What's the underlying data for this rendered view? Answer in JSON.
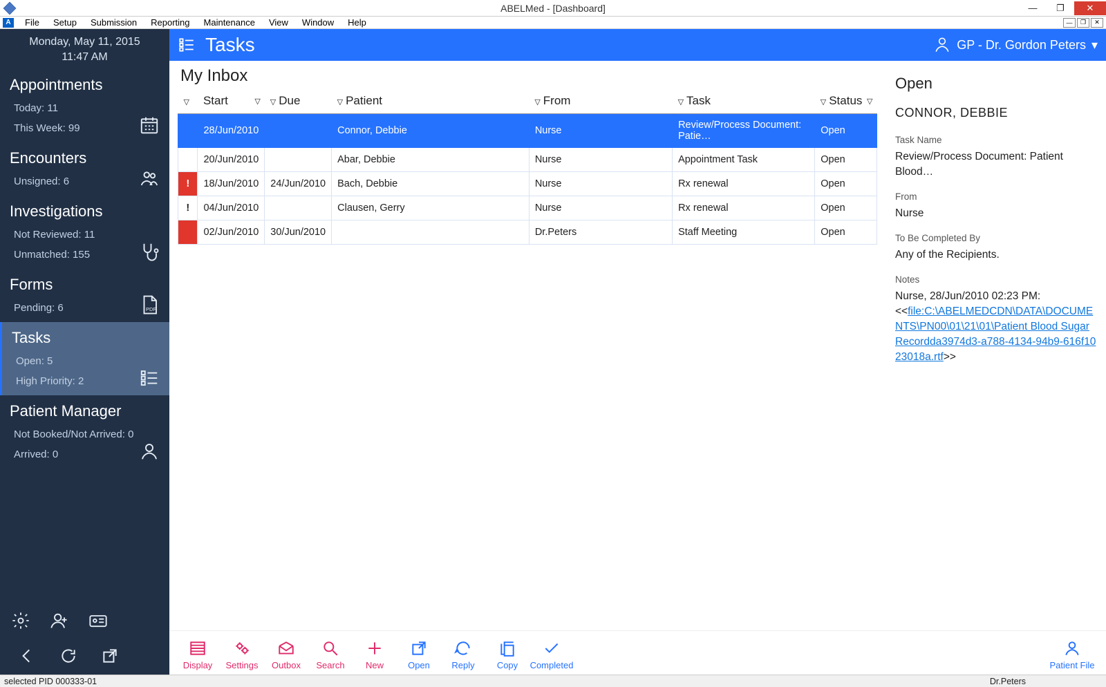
{
  "titlebar": {
    "title": "ABELMed - [Dashboard]"
  },
  "menu": [
    "File",
    "Setup",
    "Submission",
    "Reporting",
    "Maintenance",
    "View",
    "Window",
    "Help"
  ],
  "sidebar": {
    "date": "Monday, May 11, 2015",
    "time": "11:47 AM",
    "sections": [
      {
        "title": "Appointments",
        "lines": [
          "Today: 11",
          "This Week: 99"
        ]
      },
      {
        "title": "Encounters",
        "lines": [
          "Unsigned: 6"
        ]
      },
      {
        "title": "Investigations",
        "lines": [
          "Not Reviewed: 11",
          "Unmatched: 155"
        ]
      },
      {
        "title": "Forms",
        "lines": [
          "Pending: 6"
        ]
      },
      {
        "title": "Tasks",
        "lines": [
          "Open: 5",
          "High Priority: 2"
        ],
        "active": true
      },
      {
        "title": "Patient Manager",
        "lines": [
          "Not Booked/Not Arrived: 0",
          "Arrived: 0"
        ]
      }
    ]
  },
  "header": {
    "title": "Tasks",
    "user": "GP - Dr. Gordon Peters"
  },
  "inbox": {
    "title": "My Inbox"
  },
  "columns": [
    "Start",
    "Due",
    "Patient",
    "From",
    "Task",
    "Status"
  ],
  "rows": [
    {
      "flag": "",
      "flagcls": "sel",
      "start": "28/Jun/2010",
      "due": "",
      "patient": "Connor, Debbie",
      "from": "Nurse",
      "task": "Review/Process  Document:  Patie…",
      "status": "Open",
      "sel": true
    },
    {
      "flag": "",
      "flagcls": "",
      "start": "20/Jun/2010",
      "due": "",
      "patient": "Abar, Debbie",
      "from": "Nurse",
      "task": "Appointment Task",
      "status": "Open"
    },
    {
      "flag": "!",
      "flagcls": "flag-red",
      "start": "18/Jun/2010",
      "due": "24/Jun/2010",
      "patient": "Bach, Debbie",
      "from": "Nurse",
      "task": "Rx renewal",
      "status": "Open"
    },
    {
      "flag": "!",
      "flagcls": "flag-norm",
      "start": "04/Jun/2010",
      "due": "",
      "patient": "Clausen, Gerry",
      "from": "Nurse",
      "task": "Rx renewal",
      "status": "Open"
    },
    {
      "flag": "",
      "flagcls": "flag-red",
      "start": "02/Jun/2010",
      "due": "30/Jun/2010",
      "patient": "",
      "from": "Dr.Peters",
      "task": "Staff Meeting",
      "status": "Open"
    }
  ],
  "detail": {
    "status": "Open",
    "patient": "CONNOR, DEBBIE",
    "taskNameLbl": "Task Name",
    "taskName": "Review/Process Document: Patient Blood…",
    "fromLbl": "From",
    "from": "Nurse",
    "tbcLbl": "To Be Completed By",
    "tbc": "Any of the Recipients.",
    "notesLbl": "Notes",
    "noteLine": "Nurse, 28/Jun/2010 02:23 PM:",
    "link": "file:C:\\ABELMEDCDN\\DATA\\DOCUMENTS\\PN00\\01\\21\\01\\Patient Blood Sugar Recordda3974d3-a788-4134-94b9-616f1023018a.rtf"
  },
  "footer": {
    "pink": [
      "Display",
      "Settings",
      "Outbox",
      "Search",
      "New"
    ],
    "blue": [
      "Open",
      "Reply",
      "Copy",
      "Completed"
    ],
    "pfile": "Patient File"
  },
  "status": {
    "left": "selected PID 000333-01",
    "right": "Dr.Peters"
  }
}
